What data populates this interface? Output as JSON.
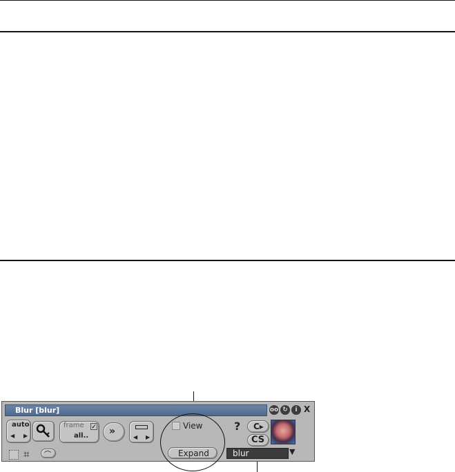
{
  "window": {
    "title": "Blur [blur]",
    "title_buttons": [
      "view-icon",
      "refresh-icon",
      "info-icon",
      "close-icon"
    ]
  },
  "controls": {
    "auto_label": "auto",
    "frame_label": "frame",
    "frame_checked": true,
    "all_label": "all..",
    "view_label": "View",
    "view_checked": false,
    "expand_label": "Expand",
    "help_label": "?",
    "cs_label": "S",
    "preset_value": "blur"
  },
  "colors": {
    "panel_bg": "#b8b8b8",
    "titlebar": "#5a7599",
    "preset_field": "#3b3b3b"
  }
}
